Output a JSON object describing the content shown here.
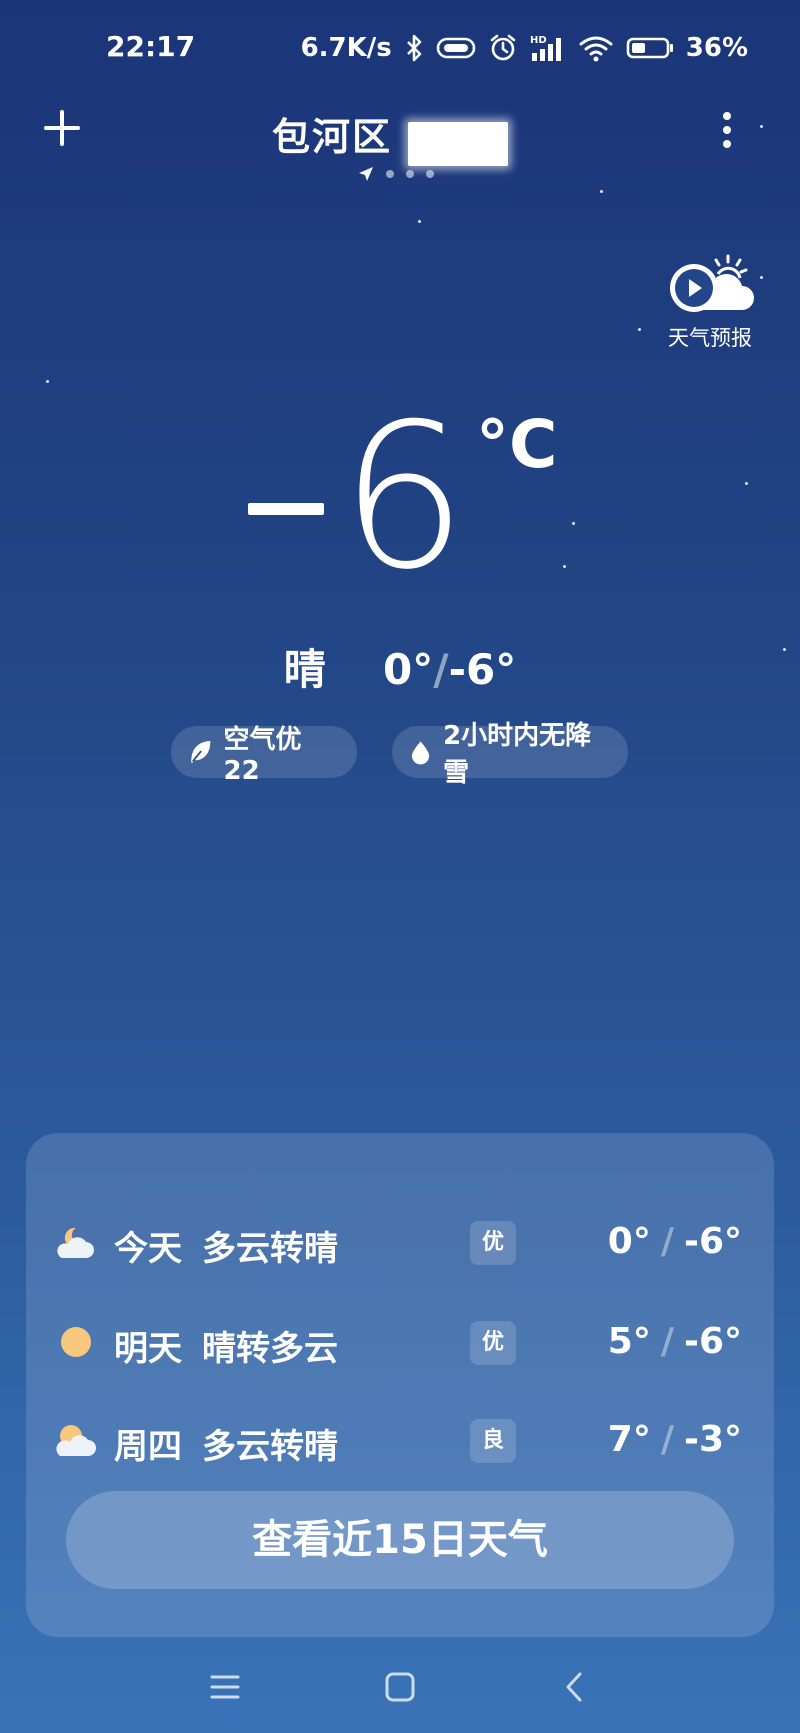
{
  "status_bar": {
    "time": "22:17",
    "network_speed": "6.7K/s",
    "battery": "36%",
    "icons": [
      "bluetooth-icon",
      "vibrate-icon",
      "alarm-icon",
      "signal-hd-icon",
      "wifi-icon",
      "battery-icon"
    ]
  },
  "header": {
    "city": "包河区",
    "page_count": 4,
    "current_page_indicator": "location-arrow-icon"
  },
  "video": {
    "label": "天气预报"
  },
  "current": {
    "temperature": "6",
    "unit": "°C",
    "condition": "晴",
    "high": "0°",
    "low": "-6°",
    "separator": "/"
  },
  "chips": {
    "air": "空气优 22",
    "precip": "2小时内无降雪"
  },
  "forecast": [
    {
      "day": "今天",
      "condition": "多云转晴",
      "aq": "优",
      "high": "0°",
      "low": "-6°",
      "icon": "partly-cloudy-night-icon"
    },
    {
      "day": "明天",
      "condition": "晴转多云",
      "aq": "优",
      "high": "5°",
      "low": "-6°",
      "icon": "sun-icon"
    },
    {
      "day": "周四",
      "condition": "多云转晴",
      "aq": "良",
      "high": "7°",
      "low": "-3°",
      "icon": "partly-cloudy-icon"
    }
  ],
  "view15_label": "查看近15日天气",
  "colors": {
    "bg_top": "#1b3579",
    "bg_bottom": "#3a73b8",
    "sun": "#f6c77d"
  }
}
